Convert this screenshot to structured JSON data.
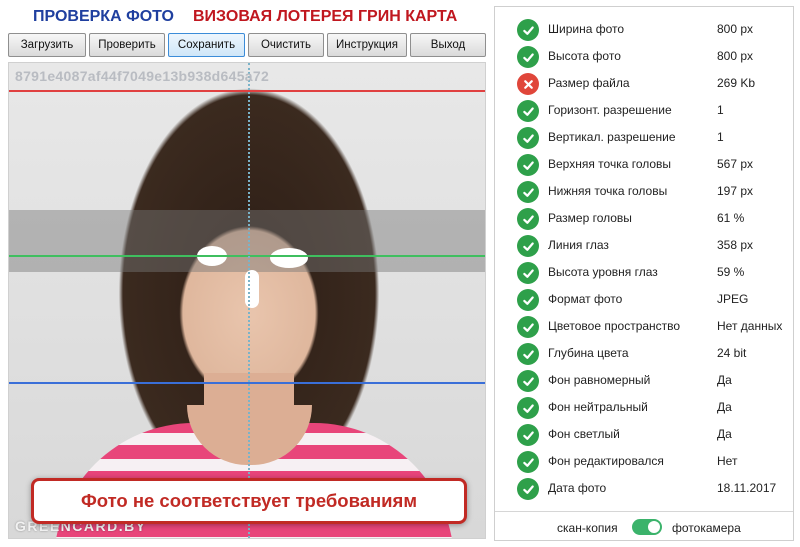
{
  "header": {
    "title_left": "ПРОВЕРКА ФОТО",
    "title_right": "ВИЗОВАЯ ЛОТЕРЕЯ ГРИН КАРТА",
    "title_left_color": "#1f3f9f",
    "title_right_color": "#c0171f"
  },
  "toolbar": {
    "buttons": [
      {
        "label": "Загрузить"
      },
      {
        "label": "Проверить"
      },
      {
        "label": "Сохранить",
        "active": true
      },
      {
        "label": "Очистить"
      },
      {
        "label": "Инструкция"
      },
      {
        "label": "Выход"
      }
    ]
  },
  "photo": {
    "id_text": "8791e4087af44f7049e13b938d645a72",
    "watermark": "GREENCARD.BY",
    "result_message": "Фото не соответствует требованиям",
    "guide_colors": {
      "top_line": "#e04040",
      "eye_line": "#3fbf5f",
      "bottom_line": "#3a6fd8",
      "center_line": "#7ab3c9"
    }
  },
  "checks": [
    {
      "label": "Ширина фото",
      "value": "800 px",
      "status": "ok"
    },
    {
      "label": "Высота фото",
      "value": "800 px",
      "status": "ok"
    },
    {
      "label": "Размер файла",
      "value": "269 Kb",
      "status": "bad"
    },
    {
      "label": "Горизонт. разрешение",
      "value": "1",
      "status": "ok"
    },
    {
      "label": "Вертикал. разрешение",
      "value": "1",
      "status": "ok"
    },
    {
      "label": "Верхняя точка головы",
      "value": "567 px",
      "status": "ok"
    },
    {
      "label": "Нижняя точка головы",
      "value": "197 px",
      "status": "ok"
    },
    {
      "label": "Размер головы",
      "value": "61 %",
      "status": "ok"
    },
    {
      "label": "Линия глаз",
      "value": "358 px",
      "status": "ok"
    },
    {
      "label": "Высота уровня глаз",
      "value": "59 %",
      "status": "ok"
    },
    {
      "label": "Формат фото",
      "value": "JPEG",
      "status": "ok"
    },
    {
      "label": "Цветовое пространство",
      "value": "Нет данных",
      "status": "ok"
    },
    {
      "label": "Глубина цвета",
      "value": "24 bit",
      "status": "ok"
    },
    {
      "label": "Фон равномерный",
      "value": "Да",
      "status": "ok"
    },
    {
      "label": "Фон нейтральный",
      "value": "Да",
      "status": "ok"
    },
    {
      "label": "Фон светлый",
      "value": "Да",
      "status": "ok"
    },
    {
      "label": "Фон редактировался",
      "value": "Нет",
      "status": "ok"
    },
    {
      "label": "Дата фото",
      "value": "18.11.2017",
      "status": "ok"
    }
  ],
  "status_colors": {
    "ok": "#2ea04a",
    "bad": "#e0463a"
  },
  "source_switch": {
    "left_label": "скан-копия",
    "right_label": "фотокамера",
    "selected": "фотокамера"
  }
}
